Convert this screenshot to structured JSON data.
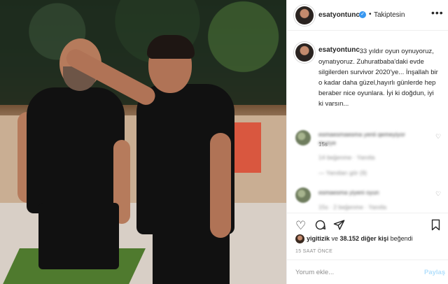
{
  "post": {
    "username": "esatyontunc",
    "verified_mark": "✓",
    "separator": "•",
    "follow_status": "Takiptesin",
    "more": "•••"
  },
  "caption": {
    "username": "esatyontunc",
    "text": "33 yıldır oyun oynuyoruz, oynatıyoruz. Zuhuratbaba'daki evde silgilerden survivor 2020'ye... İnşallah bir o kadar daha güzel,hayırlı günlerde hep beraber nice oyunlara. İyi ki doğdun, iyi ki varsın...",
    "time": "15s"
  },
  "comments": [
    {
      "text": "esmaesmaesma yenii qemeyiyor",
      "sub": "muzye",
      "meta": "14 beğenme · Yanıtla",
      "replies": "— Yanıtları gör (9)"
    },
    {
      "text": "esmaesma yiyeni oyun",
      "meta": "15s · 2 beğenme · Yanıtla"
    }
  ],
  "actions": {
    "like_icon": "heart-icon",
    "comment_icon": "comment-icon",
    "share_icon": "share-icon",
    "save_icon": "bookmark-icon"
  },
  "likes": {
    "user": "yigitizik",
    "connector": " ve ",
    "count": "38.152 diğer kişi",
    "suffix": " beğendi"
  },
  "timestamp": "15 SAAT ÖNCE",
  "comment_box": {
    "placeholder": "Yorum ekle...",
    "share_label": "Paylaş"
  }
}
